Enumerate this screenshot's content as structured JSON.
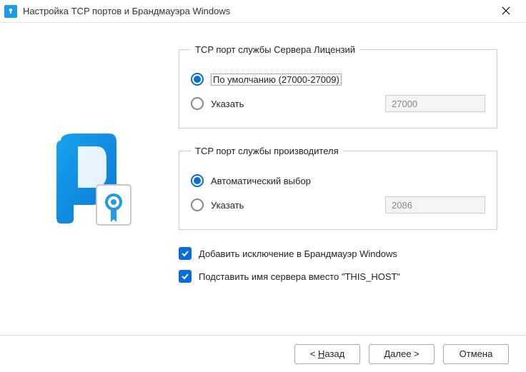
{
  "titlebar": {
    "title": "Настройка TCP портов и Брандмауэра Windows"
  },
  "license_group": {
    "legend": "TCP порт службы Сервера Лицензий",
    "default_label": "По умолчанию (27000-27009)",
    "specify_label": "Указать",
    "port_value": "27000",
    "selected": "default"
  },
  "vendor_group": {
    "legend": "TCP порт службы производителя",
    "auto_label": "Автоматический выбор",
    "specify_label": "Указать",
    "port_value": "2086",
    "selected": "auto"
  },
  "firewall_exception": {
    "label": "Добавить исключение в Брандмауэр Windows",
    "checked": true
  },
  "replace_host": {
    "label": "Подставить имя сервера вместо \"THIS_HOST\"",
    "checked": true
  },
  "buttons": {
    "back_prefix": "< ",
    "back_u": "Н",
    "back_rest": "азад",
    "next_u": "Д",
    "next_rest": "алее >",
    "cancel": "Отмена"
  }
}
